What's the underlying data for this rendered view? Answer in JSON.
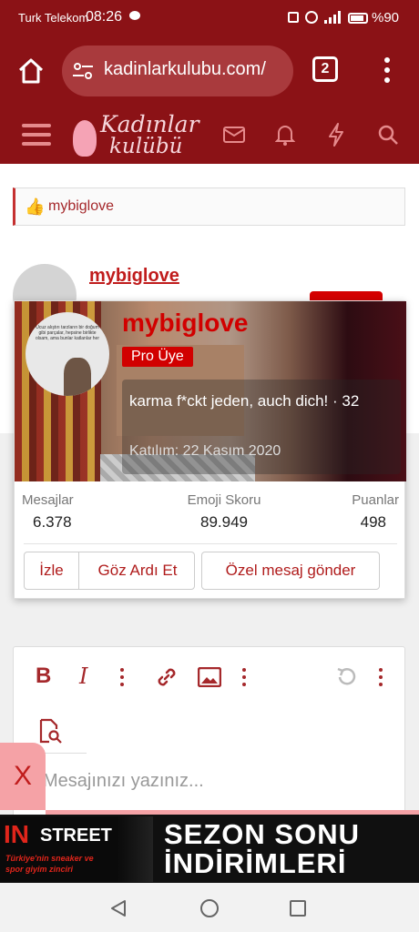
{
  "status": {
    "carrier": "Turk Telekom",
    "time": "08:26",
    "battery": "%90"
  },
  "browser": {
    "url": "kadinlarkulubu.com/",
    "tab_count": "2"
  },
  "site": {
    "logo_line1": "Kadınlar",
    "logo_line2": "kulübü"
  },
  "reaction": {
    "user": "mybiglove"
  },
  "post": {
    "author": "mybiglove"
  },
  "avatar_text": "Ucuz alıştırı tarzların bir doğum gibi parçalar, hepsine birlikte olsam, ama bunlar katlanlar her",
  "profile": {
    "username": "mybiglove",
    "badge": "Pro Üye",
    "bio": "karma f*ckt jeden, auch dich! · 32",
    "joined": "Katılım: 22 Kasım 2020",
    "stats": [
      {
        "label": "Mesajlar",
        "value": "6.378"
      },
      {
        "label": "Emoji Skoru",
        "value": "89.949"
      },
      {
        "label": "Puanlar",
        "value": "498"
      }
    ],
    "buttons": {
      "follow": "İzle",
      "ignore": "Göz Ardı Et",
      "message": "Özel mesaj gönder"
    }
  },
  "editor": {
    "placeholder": "Mesajınızı yazınız..."
  },
  "close_label": "X",
  "ad": {
    "brand_in": "IN",
    "brand_street": "STREET",
    "tagline": "Türkiye'nin sneaker ve spor giyim zinciri",
    "headline_1": "SEZON SONU",
    "headline_2": "İNDİRİMLERİ"
  },
  "colors": {
    "brand": "#8b1216",
    "accent": "#cc0000"
  }
}
